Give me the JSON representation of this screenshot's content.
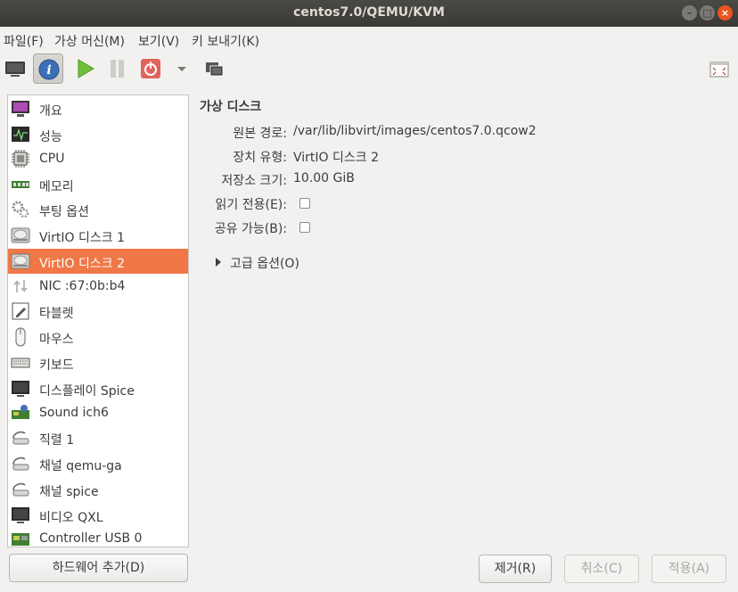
{
  "window": {
    "title": "centos7.0/QEMU/KVM"
  },
  "menubar": [
    "파일(F)",
    "가상 머신(M)",
    "보기(V)",
    "키 보내기(K)"
  ],
  "toolbar": {
    "buttons": [
      "console-view",
      "details-view",
      "run",
      "pause",
      "shutdown",
      "shutdown-menu",
      "snapshots"
    ],
    "active": "details-view"
  },
  "sidebar": {
    "items": [
      {
        "label": "개요",
        "icon": "overview-icon"
      },
      {
        "label": "성능",
        "icon": "performance-icon"
      },
      {
        "label": "CPU",
        "icon": "cpu-icon"
      },
      {
        "label": "메모리",
        "icon": "memory-icon"
      },
      {
        "label": "부팅 옵션",
        "icon": "boot-options-icon"
      },
      {
        "label": "VirtIO 디스크 1",
        "icon": "disk-icon"
      },
      {
        "label": "VirtIO 디스크 2",
        "icon": "disk-icon",
        "selected": true
      },
      {
        "label": "NIC :67:0b:b4",
        "icon": "network-icon"
      },
      {
        "label": "타블렛",
        "icon": "tablet-icon"
      },
      {
        "label": "마우스",
        "icon": "mouse-icon"
      },
      {
        "label": "키보드",
        "icon": "keyboard-icon"
      },
      {
        "label": "디스플레이 Spice",
        "icon": "display-icon"
      },
      {
        "label": "Sound ich6",
        "icon": "sound-card-icon"
      },
      {
        "label": "직렬 1",
        "icon": "serial-icon"
      },
      {
        "label": "채널 qemu-ga",
        "icon": "channel-icon"
      },
      {
        "label": "채널 spice",
        "icon": "channel-icon"
      },
      {
        "label": "비디오 QXL",
        "icon": "video-icon"
      },
      {
        "label": "Controller USB 0",
        "icon": "controller-icon"
      }
    ],
    "add_hardware": "하드웨어 추가(D)"
  },
  "details": {
    "title": "가상 디스크",
    "fields": [
      {
        "label": "원본 경로:",
        "value": "/var/lib/libvirt/images/centos7.0.qcow2"
      },
      {
        "label": "장치 유형:",
        "value": "VirtIO 디스크 2"
      },
      {
        "label": "저장소 크기:",
        "value": "10.00 GiB"
      }
    ],
    "checkboxes": [
      {
        "label": "읽기 전용(E):",
        "checked": false
      },
      {
        "label": "공유 가능(B):",
        "checked": false
      }
    ],
    "advanced": "고급 옵션(O)"
  },
  "buttons": {
    "remove": "제거(R)",
    "cancel": "취소(C)",
    "apply": "적용(A)"
  },
  "colors": {
    "selection": "#f07746",
    "close_button": "#e95420",
    "titlebar": "#3c3b37"
  }
}
